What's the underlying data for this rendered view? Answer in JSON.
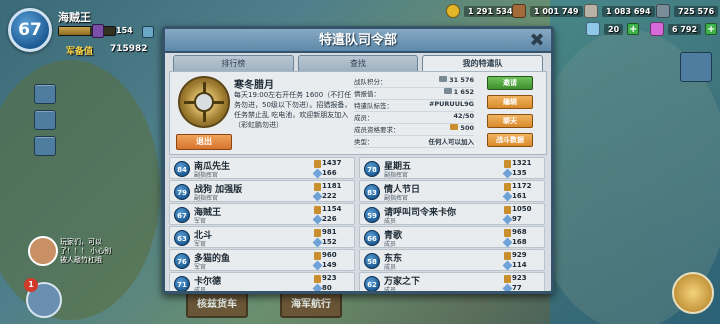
{
  "hud": {
    "level": "67",
    "player_name": "海贼王",
    "xp_value": "154",
    "xp_progress": 0.55,
    "rank_label": "军备值",
    "rank_value": "715982",
    "gold": "1 291 534",
    "wood": "1 001 749",
    "stone": "1 083 694",
    "iron": "725 576",
    "diamonds": "20",
    "gems": "6 792"
  },
  "chat": {
    "text": "玩家们，可以了！！！ 小心别被人敲竹杠哦"
  },
  "hammer_count": "1",
  "bottom_buttons": [
    "核兹货车",
    "海军航行"
  ],
  "panel": {
    "title": "特遣队司令部",
    "close": "✖",
    "tabs": [
      "排行榜",
      "查找",
      "我的特遣队"
    ],
    "active_tab": 2
  },
  "guild": {
    "name": "寒冬腊月",
    "description": "每天19:00左右开任务 1600（不打任务勿进，50级以下勿进）。招猎报备，任务禁止乱 吃电池，欢迎新朋友加入（彩虹鹏勿进）",
    "leave_label": "退出",
    "stats": [
      {
        "label": "战队积分：",
        "value": "31 576"
      },
      {
        "label": "情报值：",
        "value": "1 652"
      },
      {
        "label": "特遣队标签：",
        "value": "#PURUUL9G"
      },
      {
        "label": "成员：",
        "value": "42/50"
      },
      {
        "label": "成员资格要求：",
        "value": "500"
      },
      {
        "label": "类型：",
        "value": "任何人可以加入"
      }
    ],
    "actions": [
      "邀请",
      "编辑",
      "聊天",
      "战斗数据"
    ]
  },
  "members": [
    {
      "rank": "84",
      "name": "南瓜先生",
      "role": "副指挥官",
      "trophies": "1437",
      "gems": "166"
    },
    {
      "rank": "78",
      "name": "星期五",
      "role": "副指挥官",
      "trophies": "1321",
      "gems": "135"
    },
    {
      "rank": "79",
      "name": "战狗 加强版",
      "role": "副指挥官",
      "trophies": "1181",
      "gems": "222"
    },
    {
      "rank": "83",
      "name": "情人节日",
      "role": "副指挥官",
      "trophies": "1172",
      "gems": "161"
    },
    {
      "rank": "67",
      "name": "海贼王",
      "role": "军官",
      "trophies": "1154",
      "gems": "226"
    },
    {
      "rank": "59",
      "name": "请呼叫司令来卡你",
      "role": "成员",
      "trophies": "1050",
      "gems": "97"
    },
    {
      "rank": "63",
      "name": "北斗",
      "role": "军官",
      "trophies": "981",
      "gems": "152"
    },
    {
      "rank": "66",
      "name": "青歌",
      "role": "成员",
      "trophies": "968",
      "gems": "168"
    },
    {
      "rank": "76",
      "name": "多猫的鱼",
      "role": "军官",
      "trophies": "960",
      "gems": "149"
    },
    {
      "rank": "58",
      "name": "东东",
      "role": "成员",
      "trophies": "929",
      "gems": "114"
    },
    {
      "rank": "71",
      "name": "卡尔德",
      "role": "成员",
      "trophies": "923",
      "gems": "80"
    },
    {
      "rank": "62",
      "name": "万家之下",
      "role": "成员",
      "trophies": "923",
      "gems": "77"
    }
  ]
}
